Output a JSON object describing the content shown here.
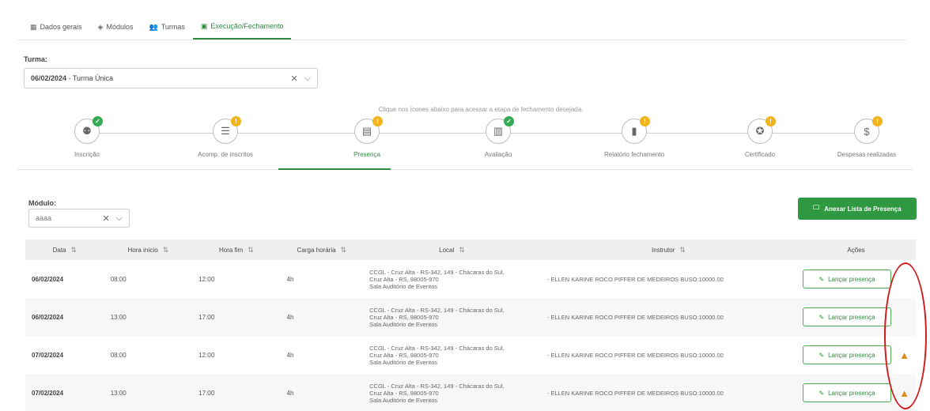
{
  "tabs": [
    {
      "label": "Dados gerais",
      "icon": "grid-icon"
    },
    {
      "label": "Módulos",
      "icon": "modules-icon"
    },
    {
      "label": "Turmas",
      "icon": "people-icon"
    },
    {
      "label": "Execução/Fechamento",
      "icon": "check-doc-icon",
      "active": true
    }
  ],
  "turma": {
    "label": "Turma:",
    "value_date": "06/02/2024",
    "value_rest": " - Turma Única"
  },
  "hint": "Clique nos ícones abaixo para acessar a etapa de fechamento desejada.",
  "steps": [
    {
      "label": "Inscrição",
      "icon": "inscricao-icon",
      "status": "ok"
    },
    {
      "label": "Acomp. de inscritos",
      "icon": "list-icon",
      "status": "pending"
    },
    {
      "label": "Presença",
      "icon": "presence-icon",
      "status": "pending",
      "active": true
    },
    {
      "label": "Avaliação",
      "icon": "evaluation-icon",
      "status": "ok"
    },
    {
      "label": "Relatório fechamento",
      "icon": "report-icon",
      "status": "pending"
    },
    {
      "label": "Certificado",
      "icon": "certificate-icon",
      "status": "pending"
    },
    {
      "label": "Despesas realizadas",
      "icon": "dollar-icon",
      "status": "pending"
    }
  ],
  "modulo": {
    "label": "Módulo:",
    "value": "aaaa"
  },
  "anexar_label": "Anexar Lista de Presença",
  "table": {
    "headers": [
      "Data",
      "Hora início",
      "Hora fim",
      "Carga horária",
      "Local",
      "Instrutor",
      "Ações"
    ],
    "rows": [
      {
        "data": "06/02/2024",
        "inicio": "08:00",
        "fim": "12:00",
        "carga": "4h",
        "local1": "CCGL - Cruz Alta - RS-342, 149 - Chácaras do Sul,",
        "local2": "Cruz Alta - RS, 98005-970",
        "local3": "Sala Auditório de Eventos",
        "instrutor": "- ELLEN KARINE ROCO PIFFER DE MEDEIROS BUSO:10000.00",
        "acao": "Lançar presença",
        "warn": false
      },
      {
        "data": "06/02/2024",
        "inicio": "13:00",
        "fim": "17:00",
        "carga": "4h",
        "local1": "CCGL - Cruz Alta - RS-342, 149 - Chácaras do Sul,",
        "local2": "Cruz Alta - RS, 98005-970",
        "local3": "Sala Auditório de Eventos",
        "instrutor": "- ELLEN KARINE ROCO PIFFER DE MEDEIROS BUSO:10000.00",
        "acao": "Lançar presença",
        "warn": false
      },
      {
        "data": "07/02/2024",
        "inicio": "08:00",
        "fim": "12:00",
        "carga": "4h",
        "local1": "CCGL - Cruz Alta - RS-342, 149 - Chácaras do Sul,",
        "local2": "Cruz Alta - RS, 98005-970",
        "local3": "Sala Auditório de Eventos",
        "instrutor": "- ELLEN KARINE ROCO PIFFER DE MEDEIROS BUSO:10000.00",
        "acao": "Lançar presença",
        "warn": true
      },
      {
        "data": "07/02/2024",
        "inicio": "13:00",
        "fim": "17:00",
        "carga": "4h",
        "local1": "CCGL - Cruz Alta - RS-342, 149 - Chácaras do Sul,",
        "local2": "Cruz Alta - RS, 98005-970",
        "local3": "Sala Auditório de Eventos",
        "instrutor": "- ELLEN KARINE ROCO PIFFER DE MEDEIROS BUSO:10000.00",
        "acao": "Lançar presença",
        "warn": true
      }
    ]
  },
  "colors": {
    "accent": "#2e9940",
    "ok": "#34a853",
    "pending": "#f2b41c",
    "warning": "#e08a1c",
    "annotation": "#d11a1a"
  }
}
